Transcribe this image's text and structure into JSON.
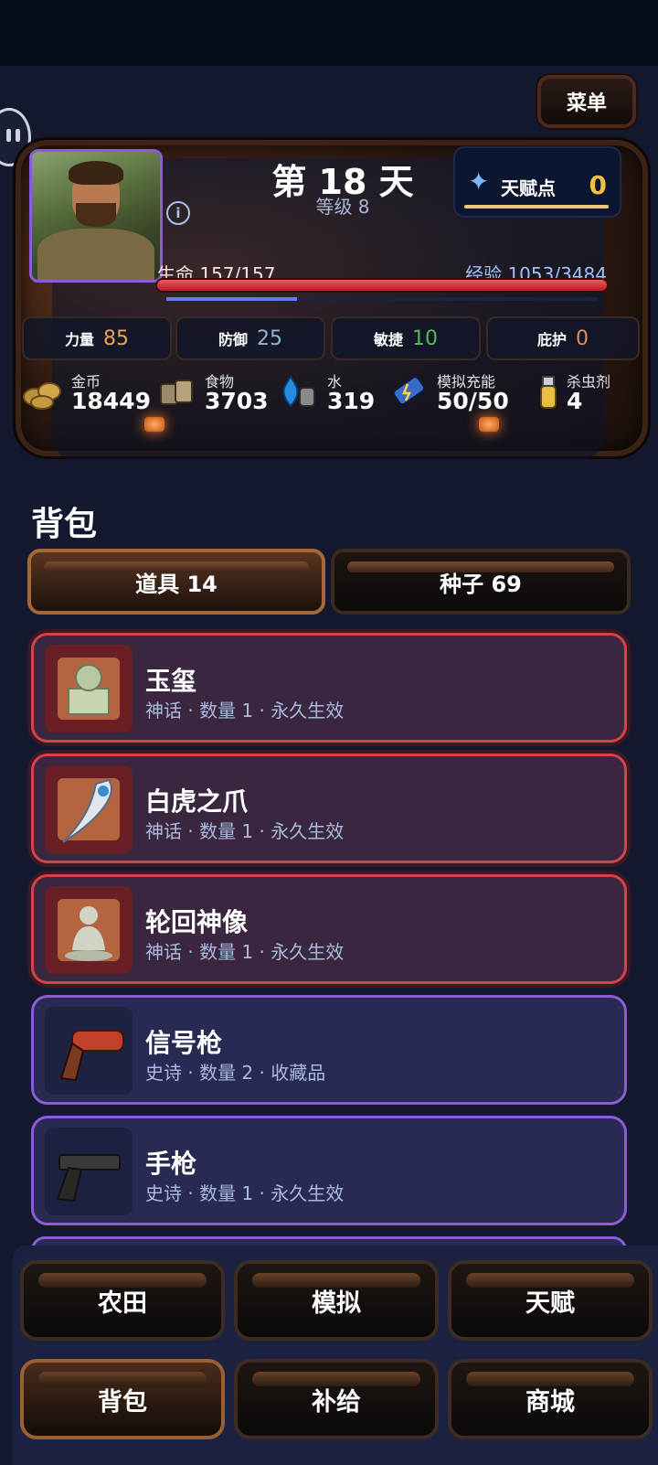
{
  "header": {
    "menu_label": "菜单"
  },
  "status": {
    "day_label": "第 18 天",
    "level_label": "等级 8",
    "info_icon": "info-icon",
    "talent": {
      "label": "天赋点",
      "value": "0",
      "icon": "diamond-icon"
    },
    "hp_label": "生命 157/157",
    "hp": {
      "current": 157,
      "max": 157
    },
    "exp_label": "经验 1053/3484",
    "exp": {
      "current": 1053,
      "max": 3484
    },
    "stats": [
      {
        "label": "力量",
        "value": "85",
        "color": "#f0a050"
      },
      {
        "label": "防御",
        "value": "25",
        "color": "#8fb4d6"
      },
      {
        "label": "敏捷",
        "value": "10",
        "color": "#57b85a"
      },
      {
        "label": "庇护",
        "value": "0",
        "color": "#d89060"
      }
    ],
    "resources": [
      {
        "label": "金币",
        "value": "18449",
        "icon": "coins-icon"
      },
      {
        "label": "食物",
        "value": "3703",
        "icon": "food-cans-icon"
      },
      {
        "label": "水",
        "value": "319",
        "icon": "water-drop-icon"
      },
      {
        "label": "模拟充能",
        "value": "50/50",
        "icon": "battery-icon"
      },
      {
        "label": "杀虫剂",
        "value": "4",
        "icon": "spray-bottle-icon"
      }
    ]
  },
  "inventory": {
    "title": "背包",
    "tabs": [
      {
        "label": "道具 14",
        "active": true
      },
      {
        "label": "种子 69",
        "active": false
      }
    ],
    "items": [
      {
        "name": "玉玺",
        "meta": "神话 · 数量 1 · 永久生效",
        "rarity": "mythic",
        "icon": "jade-seal-icon"
      },
      {
        "name": "白虎之爪",
        "meta": "神话 · 数量 1 · 永久生效",
        "rarity": "mythic",
        "icon": "tiger-claw-icon"
      },
      {
        "name": "轮回神像",
        "meta": "神话 · 数量 1 · 永久生效",
        "rarity": "mythic",
        "icon": "buddha-statue-icon"
      },
      {
        "name": "信号枪",
        "meta": "史诗 · 数量 2 · 收藏品",
        "rarity": "epic",
        "icon": "flare-gun-icon"
      },
      {
        "name": "手枪",
        "meta": "史诗 · 数量 1 · 永久生效",
        "rarity": "epic",
        "icon": "pistol-icon"
      }
    ]
  },
  "nav": [
    {
      "label": "农田",
      "active": false
    },
    {
      "label": "模拟",
      "active": false
    },
    {
      "label": "天赋",
      "active": false
    },
    {
      "label": "背包",
      "active": true
    },
    {
      "label": "补给",
      "active": false
    },
    {
      "label": "商城",
      "active": false
    }
  ]
}
